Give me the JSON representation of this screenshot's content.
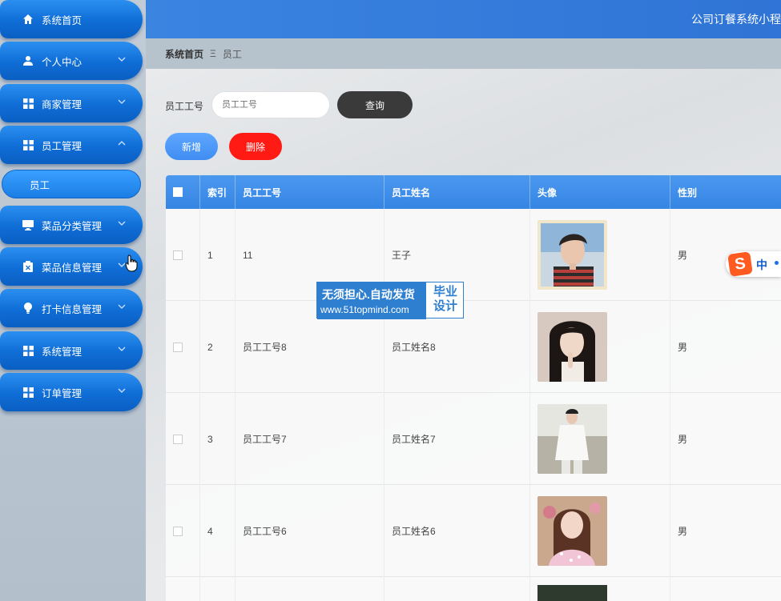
{
  "sidebar": {
    "items": [
      {
        "label": "系统首页",
        "icon": "home-icon",
        "has_arrow": false
      },
      {
        "label": "个人中心",
        "icon": "user-icon",
        "has_arrow": true
      },
      {
        "label": "商家管理",
        "icon": "grid-icon",
        "has_arrow": true
      },
      {
        "label": "员工管理",
        "icon": "grid-icon",
        "has_arrow": true,
        "expanded": true
      },
      {
        "label": "菜品分类管理",
        "icon": "monitor-icon",
        "has_arrow": true
      },
      {
        "label": "菜品信息管理",
        "icon": "clipboard-icon",
        "has_arrow": true
      },
      {
        "label": "打卡信息管理",
        "icon": "bulb-icon",
        "has_arrow": true
      },
      {
        "label": "系统管理",
        "icon": "grid-icon",
        "has_arrow": true
      },
      {
        "label": "订单管理",
        "icon": "grid-icon",
        "has_arrow": true
      }
    ],
    "submenu": {
      "label": "员工"
    }
  },
  "header": {
    "title": "公司订餐系统小程"
  },
  "breadcrumb": {
    "home": "系统首页",
    "separator": "Ξ",
    "current": "员工"
  },
  "search": {
    "label": "员工工号",
    "placeholder": "员工工号",
    "query_button": "查询"
  },
  "actions": {
    "add": "新增",
    "delete": "删除"
  },
  "table": {
    "columns": [
      "索引",
      "员工工号",
      "员工姓名",
      "头像",
      "性别"
    ],
    "rows": [
      {
        "index": "1",
        "emp_no": "11",
        "name": "王子",
        "gender": "男"
      },
      {
        "index": "2",
        "emp_no": "员工工号8",
        "name": "员工姓名8",
        "gender": "男"
      },
      {
        "index": "3",
        "emp_no": "员工工号7",
        "name": "员工姓名7",
        "gender": "男"
      },
      {
        "index": "4",
        "emp_no": "员工工号6",
        "name": "员工姓名6",
        "gender": "男"
      }
    ]
  },
  "watermark": {
    "line1": "无须担心.自动发货",
    "line2": "www.51topmind.com",
    "side": "毕业设计"
  },
  "ime": {
    "label": "中"
  },
  "colors": {
    "primary": "#1a73e8",
    "header": "#3b84e0",
    "delete": "#ff1a14",
    "query": "#3a3a3a"
  }
}
